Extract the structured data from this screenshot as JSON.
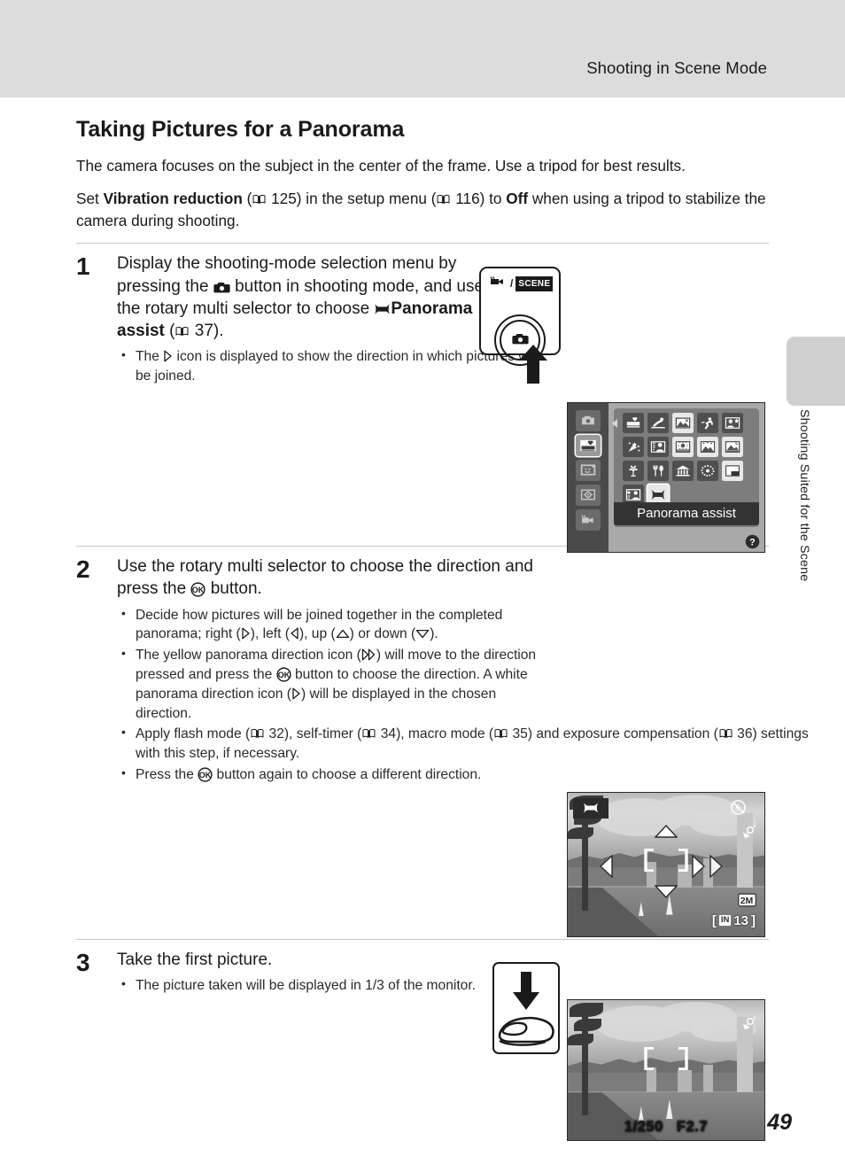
{
  "header": {
    "running_head": "Shooting in Scene Mode"
  },
  "page": {
    "heading": "Taking Pictures for a Panorama",
    "number": "49",
    "side_tab_label": "Shooting Suited for the Scene"
  },
  "intro": {
    "paragraph1": "The camera focuses on the subject in the center of the frame. Use a tripod for best results.",
    "p2_pre": "Set ",
    "p2_bold1": "Vibration reduction",
    "p2_ref1": "125",
    "p2_mid": " in the setup menu (",
    "p2_ref2": "116",
    "p2_mid2": ") to ",
    "p2_bold2": "Off",
    "p2_post": " when using a tripod to stabilize the camera during shooting."
  },
  "steps": [
    {
      "number": "1",
      "title_part1": "Display the shooting-mode selection menu by pressing the ",
      "title_part2": " button in shooting mode, and use the rotary multi selector to choose ",
      "title_bold": "Panorama assist",
      "title_ref": "37",
      "title_end": ").",
      "bullets": [
        {
          "pre": "The ",
          "mid": " icon is displayed to show the direction in which pictures will be joined."
        }
      ]
    },
    {
      "number": "2",
      "title_part1": "Use the rotary multi selector to choose the direction and press the ",
      "title_part2": " button.",
      "bullets": [
        {
          "pre": "Decide how pictures will be joined together in the completed panorama; right (",
          "a": "), left (",
          "b": "), up (",
          "c": ") or down (",
          "d": ")."
        },
        {
          "pre": "The yellow panorama direction icon (",
          "a": ") will move to the direction pressed and press the ",
          "b": " button to choose the direction. A white panorama direction icon (",
          "c": ") will be displayed in the chosen direction."
        },
        {
          "pre": "Apply flash mode (",
          "ref1": "32",
          "a": "), self-timer (",
          "ref2": "34",
          "b": "), macro mode (",
          "ref3": "35",
          "c": ") and exposure compensation (",
          "ref4": "36",
          "d": ") settings with this step, if necessary."
        },
        {
          "pre": "Press the ",
          "a": " button again to choose a different direction."
        }
      ]
    },
    {
      "number": "3",
      "title": "Take the first picture.",
      "bullets": [
        {
          "text": "The picture taken will be displayed in 1/3 of the monitor."
        }
      ]
    }
  ],
  "figures": {
    "mode_button": {
      "movie_label": "movie-icon",
      "separator": "/",
      "scene_label": "SCENE"
    },
    "scene_menu": {
      "selected_label": "Panorama assist",
      "sidebar_icons": [
        "auto-mode-icon",
        "scene-mode-icon",
        "smart-portrait-icon",
        "subject-tracking-icon",
        "movie-mode-icon"
      ],
      "selected_sidebar_index": 1,
      "grid_icons": [
        [
          "scene-auto-selector-icon",
          "sports-icon",
          "landscape-icon",
          "sport-icon",
          "night-portrait-icon"
        ],
        [
          "party-indoor-icon",
          "portrait-icon",
          "beach-icon",
          "snow-icon",
          "sunset-icon"
        ],
        [
          "close-up-icon",
          "food-icon",
          "museum-icon",
          "fireworks-icon",
          "copy-icon"
        ],
        [
          "backlight-icon",
          "panorama-assist-icon"
        ]
      ],
      "selected_grid": "panorama-assist-icon",
      "help_icon": "question-mark-icon"
    },
    "panorama_lcd": {
      "badge_icon": "panorama-assist-icon",
      "flash_icon": "flash-off-icon",
      "vr_icon": "vibration-reduction-icon",
      "image_size": "2M",
      "memory_label": "IN",
      "shots_remaining": "13",
      "direction_arrows": [
        "up",
        "left",
        "right-white",
        "right-yellow",
        "down"
      ]
    },
    "shot_lcd": {
      "vr_icon": "vibration-reduction-icon",
      "shutter_speed": "1/250",
      "aperture": "F2.7"
    },
    "press_diagram": {
      "arrow": "down-arrow-icon",
      "finger": "finger-icon"
    }
  },
  "colors": {
    "header_band": "#dcdcdc",
    "rule": "#c9c9c9",
    "side_tab": "#cfcfcf",
    "text": "#1a1a1a",
    "lcd_panel": "#7d7d7d",
    "lcd_label": "#333333"
  }
}
